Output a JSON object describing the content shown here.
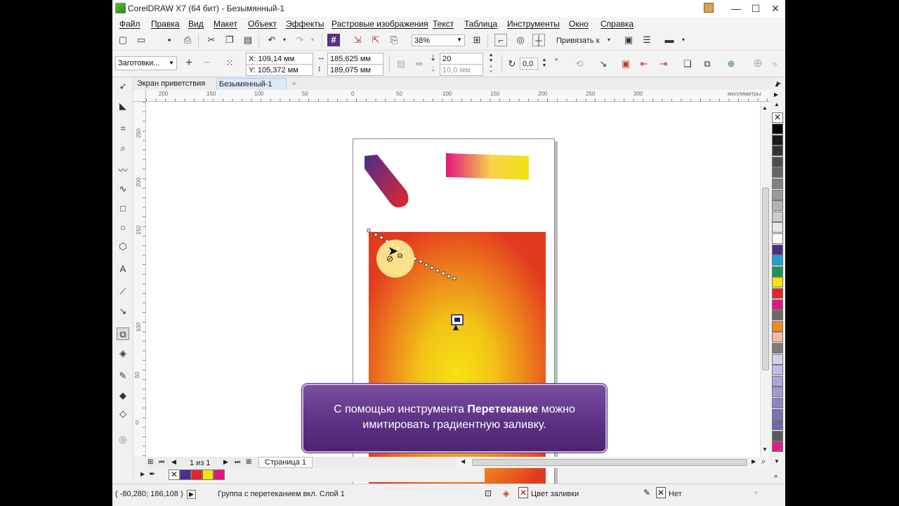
{
  "app": {
    "title": "CorelDRAW X7 (64 бит) - Безымянный-1",
    "min": "—",
    "max": "☐",
    "close": "✕"
  },
  "menu": [
    "Файл",
    "Правка",
    "Вид",
    "Макет",
    "Объект",
    "Эффекты",
    "Растровые изображения",
    "Текст",
    "Таблица",
    "Инструменты",
    "Окно",
    "Справка"
  ],
  "toolbar": {
    "zoom": "38%",
    "snap": "Привязать к"
  },
  "propbar": {
    "presets": "Заготовки...",
    "x": "X: 109,14 мм",
    "y": "Y: 105,372 мм",
    "w": "185,625 мм",
    "h": "189,075 мм",
    "steps": "20",
    "offset": "10,0 мм",
    "angle": "0,0",
    "deg": "°"
  },
  "tabs": {
    "welcome": "Экран приветствия",
    "doc": "Безымянный-1",
    "add": "+"
  },
  "ruler": {
    "units": "миллиметры",
    "top": [
      "200",
      "150",
      "100",
      "50",
      "0",
      "50",
      "100",
      "150",
      "200",
      "250",
      "300"
    ],
    "left": [
      "250",
      "200",
      "150",
      "100",
      "50",
      "0"
    ]
  },
  "pagenav": {
    "count": "1 из 1",
    "page": "Страница 1"
  },
  "status": {
    "coords": "( -80,280; 186,108 )",
    "info": "Группа с перетеканием вкл. Слой 1",
    "fill": "Цвет заливки",
    "outline": "Нет"
  },
  "caption": {
    "pre": "С помощью инструмента ",
    "bold": "Перетекание",
    "post": " можно имитировать градиентную заливку."
  },
  "palette": [
    "#000000",
    "#1a1a1a",
    "#333333",
    "#4d4d4d",
    "#666666",
    "#808080",
    "#999999",
    "#b3b3b3",
    "#cccccc",
    "#e6e6e6",
    "#ffffff",
    "#4b2d8f",
    "#1fa0d8",
    "#16985a",
    "#f2e20f",
    "#e4262b",
    "#e3157f",
    "#6a6a6a",
    "#ef8a1b",
    "#f7b7a6",
    "#7c7c7c",
    "#d6cfe8",
    "#c3bce0",
    "#a9a6de",
    "#9f9bd3",
    "#8d84c6",
    "#7a73b9",
    "#676aa8",
    "#5a5a5a",
    "#e01f8a"
  ],
  "docpal": [
    "#4b2d8f",
    "#e4262b",
    "#f2e20f",
    "#e3157f"
  ]
}
